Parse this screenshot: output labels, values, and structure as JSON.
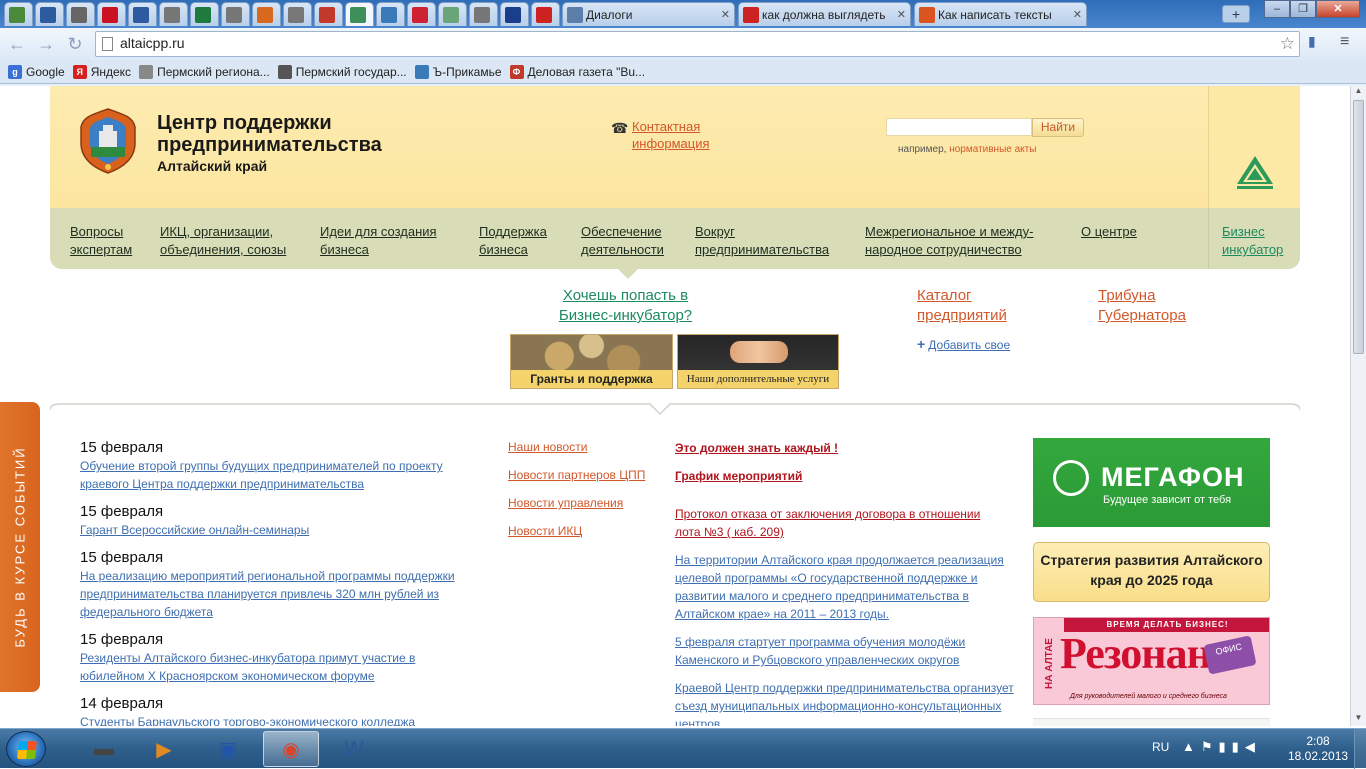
{
  "browser": {
    "tabs": [
      {
        "title": "",
        "color": "#4a8a3a"
      },
      {
        "title": "",
        "color": "#2e5aa0"
      },
      {
        "title": "",
        "color": "#666666"
      },
      {
        "title": "",
        "color": "#cc1122"
      },
      {
        "title": "",
        "color": "#2e5aa0"
      },
      {
        "title": "",
        "color": "#777777"
      },
      {
        "title": "",
        "color": "#1f7a3d"
      },
      {
        "title": "",
        "color": "#777777"
      },
      {
        "title": "",
        "color": "#d9691e"
      },
      {
        "title": "",
        "color": "#777777"
      },
      {
        "title": "",
        "color": "#c0392b"
      },
      {
        "title": "",
        "color": "#3f8f5a"
      },
      {
        "title": "",
        "color": "#3a7ab8"
      },
      {
        "title": "",
        "color": "#cc2233"
      },
      {
        "title": "",
        "color": "#6aa57a"
      },
      {
        "title": "",
        "color": "#777777"
      },
      {
        "title": "",
        "color": "#1a3e8c"
      },
      {
        "title": "",
        "color": "#cc2222"
      },
      {
        "title": "Диалоги",
        "color": "#5b7fa8"
      },
      {
        "title": "как должна выглядеть",
        "color": "#cc2222"
      },
      {
        "title": "Как написать тексты",
        "color": "#d9541e"
      }
    ],
    "url": "altaicpp.ru",
    "bookmarks": [
      {
        "label": "Google",
        "color": "#3a6fd8",
        "glyph": "g"
      },
      {
        "label": "Яндекс",
        "color": "#d42020",
        "glyph": "Я"
      },
      {
        "label": "Пермский региона...",
        "color": "#888888",
        "glyph": ""
      },
      {
        "label": "Пермский государ...",
        "color": "#555555",
        "glyph": ""
      },
      {
        "label": "Ъ-Прикамье",
        "color": "#3a7ab8",
        "glyph": ""
      },
      {
        "label": "Деловая газета \"Bu...",
        "color": "#c0392b",
        "glyph": "Ф"
      }
    ]
  },
  "site": {
    "brand_line1": "Центр поддержки",
    "brand_line2": "предпринимательства",
    "brand_region": "Алтайский край",
    "contact_icon": "☎",
    "contact_label": "Контактная информация",
    "search_placeholder": "",
    "search_button": "Найти",
    "search_hint_prefix": "например,",
    "search_hint_link": "нормативные акты",
    "nav": [
      {
        "label": "Вопросы экспертам"
      },
      {
        "label": "ИКЦ, организации, объединения, союзы"
      },
      {
        "label": "Идеи для создания бизнеса"
      },
      {
        "label": "Поддержка бизнеса"
      },
      {
        "label": "Обеспечение деятельности"
      },
      {
        "label": "Вокруг предпринимательства"
      },
      {
        "label": "Межрегиональное и между-народное сотрудничество"
      },
      {
        "label": "О центре"
      }
    ],
    "nav_incubator": "Бизнес инкубатор",
    "promo_incubator": "Хочешь попасть в Бизнес-инкубатор?",
    "catalog_link": "Каталог предприятий",
    "tribune_link": "Трибуна Губернатора",
    "add_own": "Добавить свое",
    "banner_grants": "Гранты и поддержка",
    "banner_services": "Наши дополнительные услуги",
    "events_tab": "БУДЬ В КУРСЕ СОБЫТИЙ"
  },
  "news": [
    {
      "date": "15 февраля",
      "text": "Обучение второй группы будущих предпринимателей по проекту краевого Центра поддержки предпринимательства"
    },
    {
      "date": "15 февраля",
      "text": "Гарант Всероссийские онлайн-семинары"
    },
    {
      "date": "15 февраля",
      "text": "На реализацию мероприятий региональной программы поддержки предпринимательства планируется привлечь 320 млн рублей из федерального бюджета"
    },
    {
      "date": "15 февраля",
      "text": "Резиденты Алтайского бизнес-инкубатора примут участие в юбилейном X Красноярском экономическом форуме"
    },
    {
      "date": "14 февраля",
      "text": "Студенты Барнаульского торгово-экономического колледжа"
    }
  ],
  "news_categories": [
    "Наши новости",
    "Новости партнеров ЦПП",
    "Новости управления",
    "Новости ИКЦ"
  ],
  "middle": {
    "must_know": "Это должен знать каждый !",
    "schedule": "График мероприятий",
    "protocol": "Протокол отказа от заключения договора в отношении лота №3 ( каб. 209)",
    "items": [
      "На территории Алтайского края продолжается реализация целевой программы «О государственной поддержке и развитии малого и среднего предпринимательства в Алтайском крае» на 2011 – 2013 годы.",
      "5 февраля стартует программа обучения молодёжи Каменского и Рубцовского управленческих округов",
      "Краевой Центр поддержки предпринимательства организует съезд муниципальных информационно-консультационных центров"
    ]
  },
  "ads": {
    "megafon_name": "МЕГАФОН",
    "megafon_slogan": "Будущее зависит от тебя",
    "strategy": "Стратегия развития Алтайского края до 2025 года",
    "resonance_top": "ВРЕМЯ ДЕЛАТЬ БИЗНЕС!",
    "resonance_name": "Резонанс",
    "resonance_side": "НА АЛТАЕ",
    "resonance_badge": "ОФИС",
    "resonance_bottom": "Для руководителей малого и среднего бизнеса"
  },
  "taskbar": {
    "apps": [
      {
        "name": "explorer-app",
        "glyph": "▬",
        "color": "#444444"
      },
      {
        "name": "media-player-app",
        "glyph": "▶",
        "color": "#e08a20"
      },
      {
        "name": "save-app",
        "glyph": "▣",
        "color": "#2255aa"
      },
      {
        "name": "chrome-app",
        "glyph": "◉",
        "color": "#d9452b"
      },
      {
        "name": "word-app",
        "glyph": "W",
        "color": "#2b5797"
      }
    ],
    "lang": "RU",
    "time": "2:08",
    "date": "18.02.2013"
  }
}
